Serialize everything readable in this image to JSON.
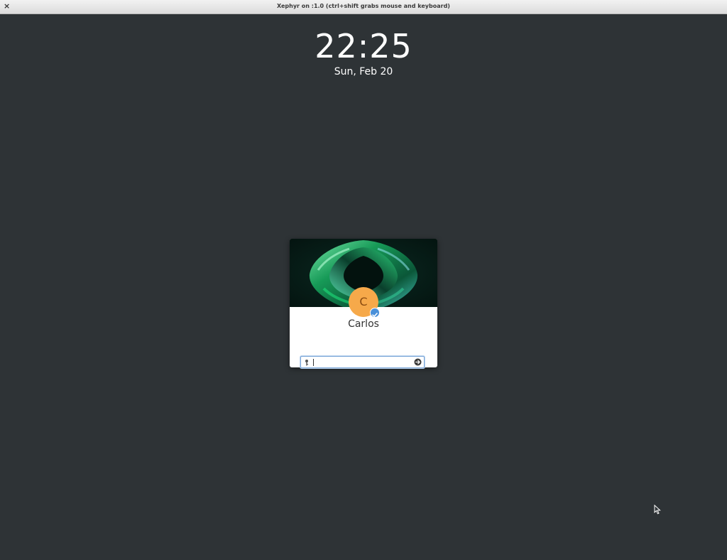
{
  "window": {
    "title": "Xephyr on :1.0 (ctrl+shift grabs mouse and keyboard)",
    "close_glyph": "×"
  },
  "lock_screen": {
    "time": "22:25",
    "date": "Sun, Feb 20"
  },
  "user_card": {
    "avatar_initial": "C",
    "avatar_color": "#f6a94a",
    "badge_icon": "checkmark-icon",
    "badge_color": "#4a90d9",
    "username": "Carlos",
    "password_field": {
      "value": "",
      "icon": "key-icon",
      "submit_icon": "arrow-right-circle-icon"
    }
  },
  "colors": {
    "background": "#2e3336",
    "field_focus": "#7aa6d8"
  }
}
